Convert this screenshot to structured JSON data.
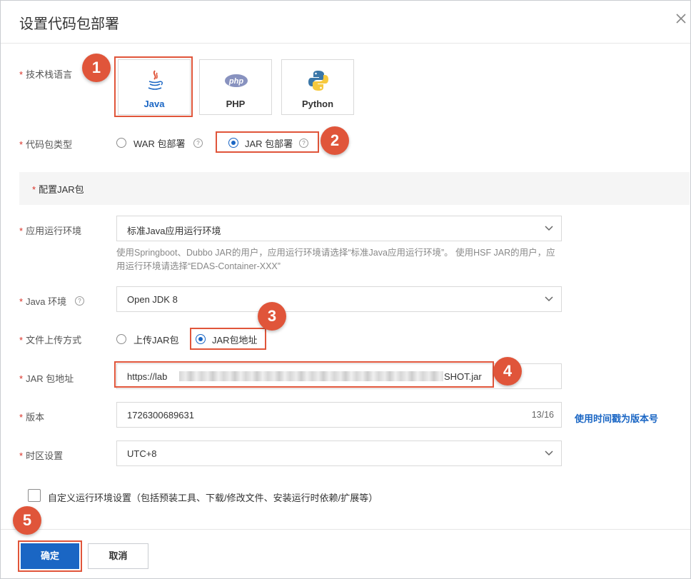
{
  "dialog": {
    "title": "设置代码包部署"
  },
  "tech_stack": {
    "label": "技术栈语言",
    "options": [
      {
        "name": "Java",
        "selected": true,
        "icon": "java-icon"
      },
      {
        "name": "PHP",
        "selected": false,
        "icon": "php-icon"
      },
      {
        "name": "Python",
        "selected": false,
        "icon": "python-icon"
      }
    ]
  },
  "package_type": {
    "label": "代码包类型",
    "options": [
      {
        "text": "WAR 包部署",
        "selected": false
      },
      {
        "text": "JAR 包部署",
        "selected": true
      }
    ]
  },
  "section": {
    "title": "配置JAR包"
  },
  "runtime": {
    "label": "应用运行环境",
    "value": "标准Java应用运行环境",
    "hint": "使用Springboot、Dubbo JAR的用户，应用运行环境请选择“标准Java应用运行环境”。 使用HSF JAR的用户，应用运行环境请选择“EDAS-Container-XXX”"
  },
  "java_env": {
    "label": "Java 环境",
    "value": "Open JDK 8"
  },
  "upload_method": {
    "label": "文件上传方式",
    "options": [
      {
        "text": "上传JAR包",
        "selected": false
      },
      {
        "text": "JAR包地址",
        "selected": true
      }
    ]
  },
  "jar_address": {
    "label": "JAR 包地址",
    "value_prefix": "https://lab",
    "value_suffix": "SHOT.jar"
  },
  "version": {
    "label": "版本",
    "value": "1726300689631",
    "counter": "13/16",
    "link": "使用时间戳为版本号"
  },
  "timezone": {
    "label": "时区设置",
    "value": "UTC+8"
  },
  "custom_env": {
    "label": "自定义运行环境设置（包括预装工具、下载/修改文件、安装运行时依赖/扩展等）",
    "checked": false
  },
  "footer": {
    "confirm": "确定",
    "cancel": "取消"
  },
  "annotations": [
    "1",
    "2",
    "3",
    "4",
    "5"
  ],
  "colors": {
    "accent": "#1a66c4",
    "highlight": "#e0553a",
    "required": "#d93026"
  }
}
